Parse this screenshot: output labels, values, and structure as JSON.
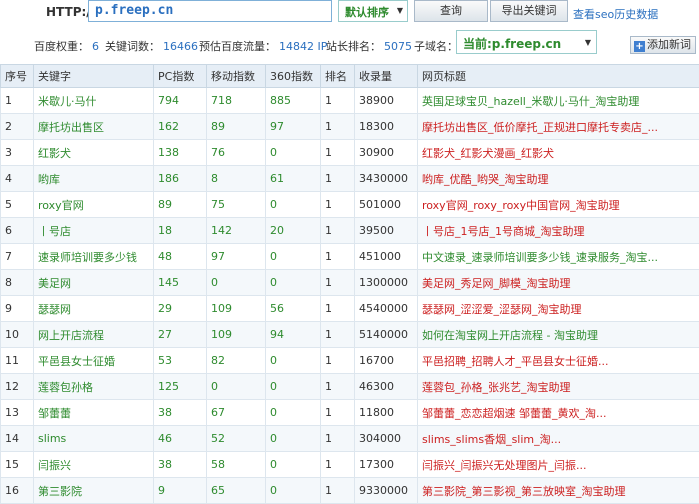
{
  "toolbar": {
    "http_label": "HTTP://",
    "url_value": "p.freep.cn",
    "sort_value": "默认排序",
    "query_label": "查询",
    "export_label": "导出关键词",
    "history_link": "查看seo历史数据"
  },
  "stats": {
    "baidu_weight_label": "百度权重：",
    "baidu_weight": "6",
    "keywords_label": "关键词数：",
    "keywords": "16466",
    "traffic_label": "预估百度流量：",
    "traffic": "14842 IP",
    "rank_label": "站长排名：",
    "rank": "5075",
    "subdomain_label": "子域名：",
    "subdomain_value": "当前:p.freep.cn",
    "add_label": "添加新词"
  },
  "table": {
    "headers": [
      "序号",
      "关键字",
      "PC指数",
      "移动指数",
      "360指数",
      "排名",
      "收录量",
      "网页标题"
    ],
    "rows": [
      [
        "1",
        "米歇儿·马什",
        "794",
        "718",
        "885",
        "1",
        "38900",
        "英国足球宝贝_hazell_米歇儿·马什_淘宝助理"
      ],
      [
        "2",
        "摩托坊出售区",
        "162",
        "89",
        "97",
        "1",
        "18300",
        "摩托坊出售区_低价摩托_正规进口摩托专卖店_..."
      ],
      [
        "3",
        "红影犬",
        "138",
        "76",
        "0",
        "1",
        "30900",
        "红影犬_红影犬漫画_红影犬"
      ],
      [
        "4",
        "哟库",
        "186",
        "8",
        "61",
        "1",
        "3430000",
        "哟库_优酷_哟哭_淘宝助理"
      ],
      [
        "5",
        "roxy官网",
        "89",
        "75",
        "0",
        "1",
        "501000",
        "roxy官网_roxy_roxy中国官网_淘宝助理"
      ],
      [
        "6",
        "丨号店",
        "18",
        "142",
        "20",
        "1",
        "39500",
        "丨号店_1号店_1号商城_淘宝助理"
      ],
      [
        "7",
        "速录师培训要多少钱",
        "48",
        "97",
        "0",
        "1",
        "451000",
        "中文速录_速录师培训要多少钱_速录服务_淘宝..."
      ],
      [
        "8",
        "美足网",
        "145",
        "0",
        "0",
        "1",
        "1300000",
        "美足网_秀足网_脚模_淘宝助理"
      ],
      [
        "9",
        "瑟瑟网",
        "29",
        "109",
        "56",
        "1",
        "4540000",
        "瑟瑟网_涩涩爱_涩瑟网_淘宝助理"
      ],
      [
        "10",
        "网上开店流程",
        "27",
        "109",
        "94",
        "1",
        "5140000",
        "如何在淘宝网上开店流程 - 淘宝助理"
      ],
      [
        "11",
        "平邑县女士征婚",
        "53",
        "82",
        "0",
        "1",
        "16700",
        "平邑招聘_招聘人才_平邑县女士征婚..."
      ],
      [
        "12",
        "莲蓉包孙格",
        "125",
        "0",
        "0",
        "1",
        "46300",
        "莲蓉包_孙格_张兆艺_淘宝助理"
      ],
      [
        "13",
        "邹蕾蕾",
        "38",
        "67",
        "0",
        "1",
        "11800",
        "邹蕾蕾_恋恋超烟速 邹蕾蕾_黄欢_淘..."
      ],
      [
        "14",
        "slims",
        "46",
        "52",
        "0",
        "1",
        "304000",
        "slims_slims香烟_slim_淘..."
      ],
      [
        "15",
        "闫振兴",
        "38",
        "58",
        "0",
        "1",
        "17300",
        "闫振兴_闫振兴无处理图片_闫振..."
      ],
      [
        "16",
        "第三影院",
        "9",
        "65",
        "0",
        "1",
        "9330000",
        "第三影院_第三影视_第三放映室_淘宝助理"
      ]
    ],
    "title_colors": [
      "green",
      "red",
      "red",
      "red",
      "red",
      "red",
      "green",
      "red",
      "red",
      "green",
      "red",
      "red",
      "red",
      "red",
      "red",
      "red"
    ]
  }
}
